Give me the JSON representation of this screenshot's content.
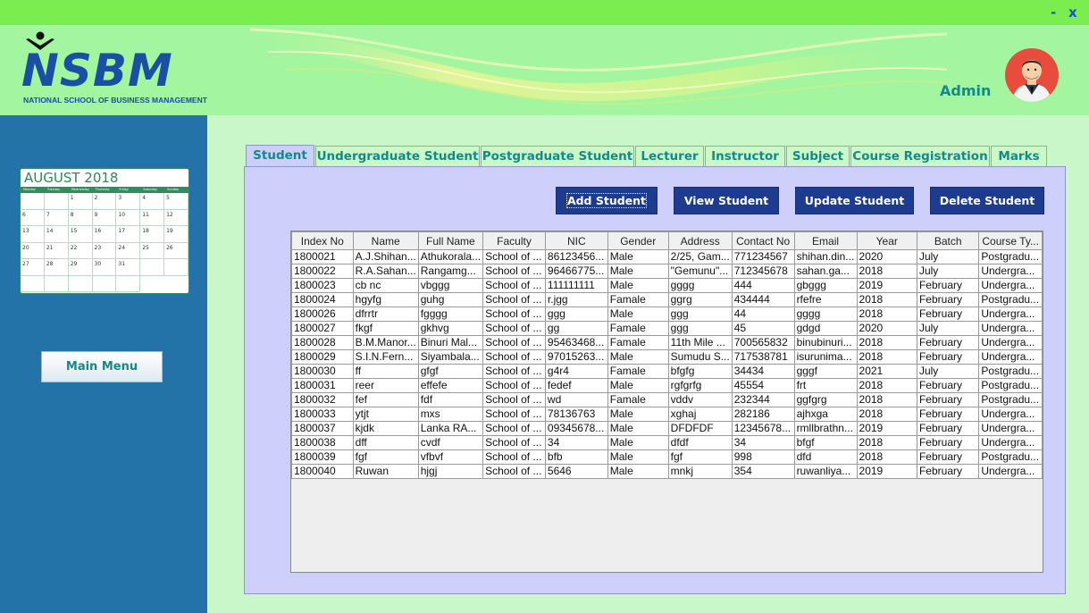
{
  "window": {
    "minimize_label": "-",
    "close_label": "x"
  },
  "header": {
    "logo_text": "NSBM",
    "logo_subtitle": "NATIONAL SCHOOL OF BUSINESS MANAGEMENT",
    "user_name": "Admin",
    "avatar_icon": "user-avatar-icon"
  },
  "sidebar": {
    "calendar": {
      "title": "AUGUST 2018",
      "weekdays": [
        "Monday",
        "Tuesday",
        "Wednesday",
        "Thursday",
        "Friday",
        "Saturday",
        "Sunday"
      ],
      "cells": [
        "",
        "",
        "1",
        "2",
        "3",
        "4",
        "5",
        "6",
        "7",
        "8",
        "9",
        "10",
        "11",
        "12",
        "13",
        "14",
        "15",
        "16",
        "17",
        "18",
        "19",
        "20",
        "21",
        "22",
        "23",
        "24",
        "25",
        "26",
        "27",
        "28",
        "29",
        "30",
        "31",
        "",
        "",
        "",
        "",
        "",
        "",
        ""
      ]
    },
    "main_menu_label": "Main Menu"
  },
  "tabs": [
    {
      "label": "Student",
      "active": true
    },
    {
      "label": "Undergraduate Student"
    },
    {
      "label": "Postgraduate Student"
    },
    {
      "label": "Lecturer"
    },
    {
      "label": "Instructor"
    },
    {
      "label": "Subject"
    },
    {
      "label": "Course Registration"
    },
    {
      "label": "Marks"
    }
  ],
  "actions": {
    "add": "Add Student",
    "view": "View Student",
    "update": "Update Student",
    "delete": "Delete Student"
  },
  "table": {
    "columns": [
      "Index No",
      "Name",
      "Full Name",
      "Faculty",
      "NIC",
      "Gender",
      "Address",
      "Contact No",
      "Email",
      "Year",
      "Batch",
      "Course Ty..."
    ],
    "rows": [
      [
        "1800021",
        "A.J.Shihan...",
        "Athukorala...",
        "School of ...",
        "86123456...",
        "Male",
        "2/25, Gam...",
        "771234567",
        "shihan.din...",
        "2020",
        "July",
        "Postgradu..."
      ],
      [
        "1800022",
        "R.A.Sahan...",
        "Rangamg...",
        "School of ...",
        "96466775...",
        "Male",
        "\"Gemunu\"...",
        "712345678",
        "sahan.ga...",
        "2018",
        "July",
        "Undergra..."
      ],
      [
        "1800023",
        "cb nc",
        "vbggg",
        "School of ...",
        "111111111",
        "Male",
        "gggg",
        "444",
        "gbggg",
        "2019",
        "February",
        "Undergra..."
      ],
      [
        "1800024",
        "hgyfg",
        "guhg",
        "School of ...",
        "r.jgg",
        "Famale",
        "ggrg",
        "434444",
        "rfefre",
        "2018",
        "February",
        "Postgradu..."
      ],
      [
        "1800026",
        "dfrrtr",
        "fgggg",
        "School of ...",
        "ggg",
        "Male",
        "ggg",
        "44",
        "gggg",
        "2018",
        "February",
        "Undergra..."
      ],
      [
        "1800027",
        "fkgf",
        "gkhvg",
        "School of ...",
        "gg",
        "Famale",
        "ggg",
        "45",
        "gdgd",
        "2020",
        "July",
        "Undergra..."
      ],
      [
        "1800028",
        "B.M.Manor...",
        "Binuri Mal...",
        "School of ...",
        "95463468...",
        "Famale",
        "11th Mile ...",
        "700565832",
        "binubinuri...",
        "2018",
        "February",
        "Undergra..."
      ],
      [
        "1800029",
        "S.I.N.Fern...",
        "Siyambala...",
        "School of ...",
        "97015263...",
        "Male",
        "Sumudu S...",
        "717538781",
        "isurunima...",
        "2018",
        "February",
        "Undergra..."
      ],
      [
        "1800030",
        "ff",
        "gfgf",
        "School of ...",
        "g4r4",
        "Famale",
        "bfgfg",
        "34434",
        "gggf",
        "2021",
        "July",
        "Postgradu..."
      ],
      [
        "1800031",
        "reer",
        "effefe",
        "School of ...",
        "fedef",
        "Male",
        "rgfgrfg",
        "45554",
        "frt",
        "2018",
        "February",
        "Postgradu..."
      ],
      [
        "1800032",
        "fef",
        "fdf",
        "School of ...",
        "wd",
        "Famale",
        "vddv",
        "232344",
        "ggfgrg",
        "2018",
        "February",
        "Postgradu..."
      ],
      [
        "1800033",
        "ytjt",
        "mxs",
        "School of ...",
        "78136763",
        "Male",
        "xghaj",
        "282186",
        "ajhxga",
        "2018",
        "February",
        "Undergra..."
      ],
      [
        "1800037",
        "kjdk",
        "Lanka RA...",
        "School of ...",
        "09345678...",
        "Male",
        "DFDFDF",
        "12345678...",
        "rmllbrathn...",
        "2019",
        "February",
        "Undergra..."
      ],
      [
        "1800038",
        "dff",
        "cvdf",
        "School of ...",
        "34",
        "Male",
        "dfdf",
        "34",
        "bfgf",
        "2018",
        "February",
        "Undergra..."
      ],
      [
        "1800039",
        "fgf",
        "vfbvf",
        "School of ...",
        "bfb",
        "Male",
        "fgf",
        "998",
        "dfd",
        "2018",
        "February",
        "Postgradu..."
      ],
      [
        "1800040",
        "Ruwan",
        "hjgj",
        "School of ...",
        "5646",
        "Male",
        "mnkj",
        "354",
        "ruwanliya...",
        "2019",
        "February",
        "Undergra..."
      ]
    ]
  }
}
